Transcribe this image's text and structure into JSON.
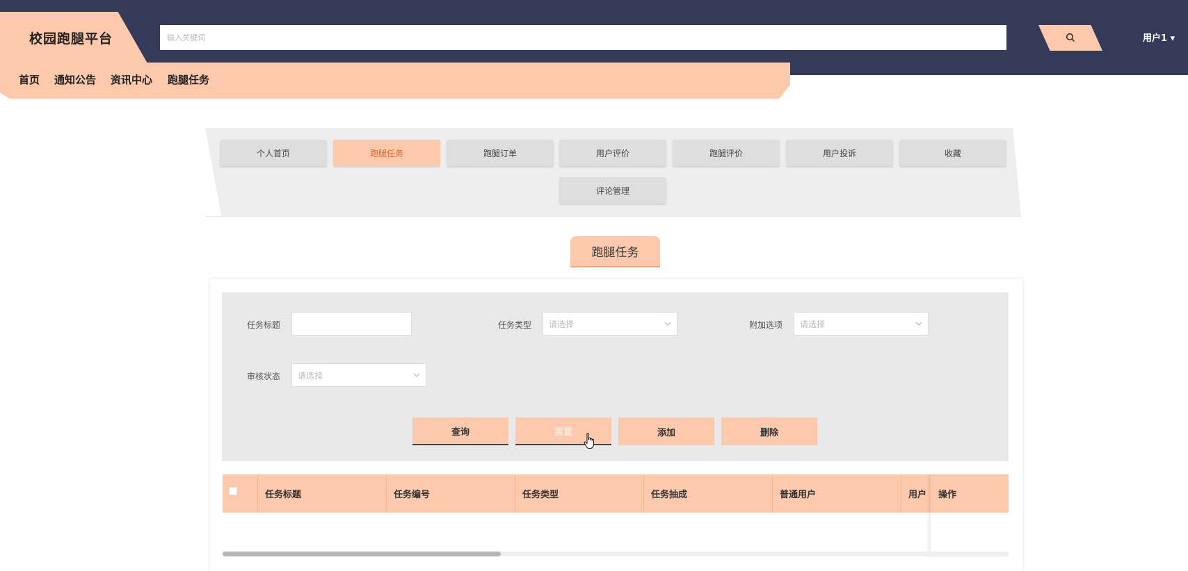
{
  "header": {
    "logo": "校园跑腿平台",
    "search_placeholder": "输入关键词",
    "user_label": "用户1 ▾"
  },
  "nav": [
    "首页",
    "通知公告",
    "资讯中心",
    "跑腿任务"
  ],
  "tabs": [
    "个人首页",
    "跑腿任务",
    "跑腿订单",
    "用户评价",
    "跑腿评价",
    "用户投诉",
    "收藏",
    "评论管理"
  ],
  "active_tab": "跑腿任务",
  "page_title": "跑腿任务",
  "filters": {
    "task_title_label": "任务标题",
    "task_type_label": "任务类型",
    "task_type_placeholder": "请选择",
    "extra_label": "附加选项",
    "extra_placeholder": "请选择",
    "review_label": "审核状态",
    "review_placeholder": "请选择"
  },
  "actions": {
    "query": "查询",
    "reset": "重置",
    "add": "添加",
    "delete": "删除"
  },
  "table": {
    "columns": [
      "任务标题",
      "任务编号",
      "任务类型",
      "任务抽成",
      "普通用户",
      "用户",
      "操作"
    ]
  },
  "colors": {
    "header_bg": "#353a58",
    "accent": "#fdc9ad",
    "active_text": "#e0662c"
  }
}
